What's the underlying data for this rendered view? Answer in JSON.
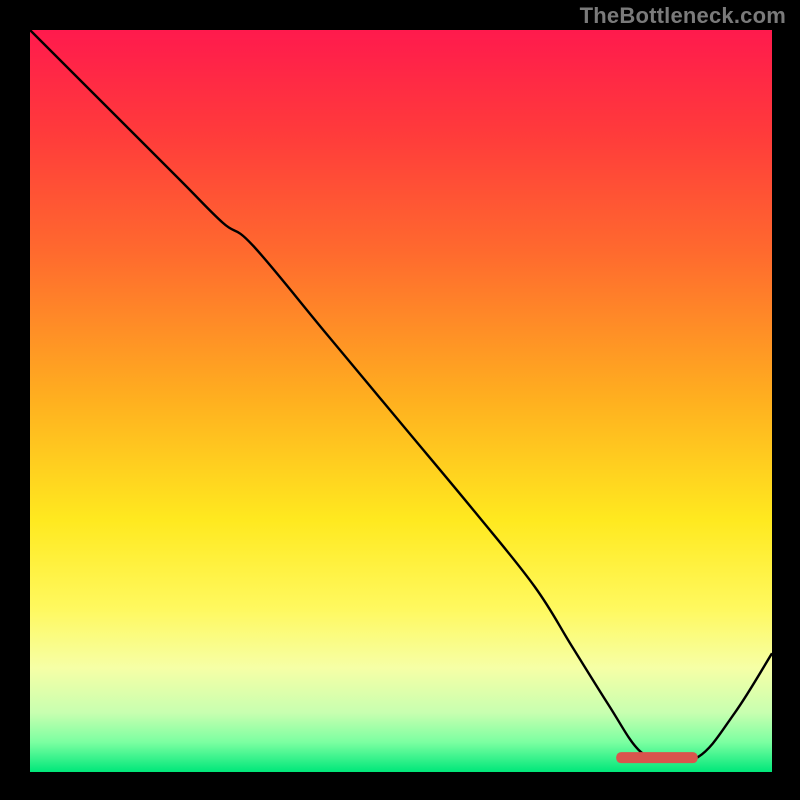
{
  "header": {
    "attribution": "TheBottleneck.com"
  },
  "palette": {
    "frame_bg": "#000000",
    "attribution_color": "#7a7a7a",
    "curve_color": "#000000",
    "marker_color": "#d9544d",
    "gradient_stops": [
      {
        "offset": 0.0,
        "color": "#ff1a4d"
      },
      {
        "offset": 0.14,
        "color": "#ff3b3b"
      },
      {
        "offset": 0.3,
        "color": "#ff6a2e"
      },
      {
        "offset": 0.5,
        "color": "#ffb01f"
      },
      {
        "offset": 0.66,
        "color": "#ffe91f"
      },
      {
        "offset": 0.78,
        "color": "#fff95f"
      },
      {
        "offset": 0.86,
        "color": "#f6ffa6"
      },
      {
        "offset": 0.92,
        "color": "#c8ffb0"
      },
      {
        "offset": 0.96,
        "color": "#7bffa1"
      },
      {
        "offset": 1.0,
        "color": "#00e77a"
      }
    ]
  },
  "chart_data": {
    "type": "line",
    "title": "",
    "xlabel": "",
    "ylabel": "",
    "xlim": [
      0,
      100
    ],
    "ylim": [
      0,
      100
    ],
    "grid": false,
    "legend": false,
    "annotations": [],
    "series": [
      {
        "name": "curve",
        "x": [
          0,
          8,
          20,
          26,
          30,
          40,
          50,
          60,
          68,
          73,
          78,
          82,
          85,
          90,
          95,
          100
        ],
        "y": [
          100,
          92,
          80,
          74,
          71,
          59,
          47,
          35,
          25,
          17,
          9,
          3,
          2,
          2,
          8,
          16
        ]
      }
    ],
    "marker": {
      "x_start": 79,
      "x_end": 90,
      "y": 2,
      "label": ""
    }
  }
}
